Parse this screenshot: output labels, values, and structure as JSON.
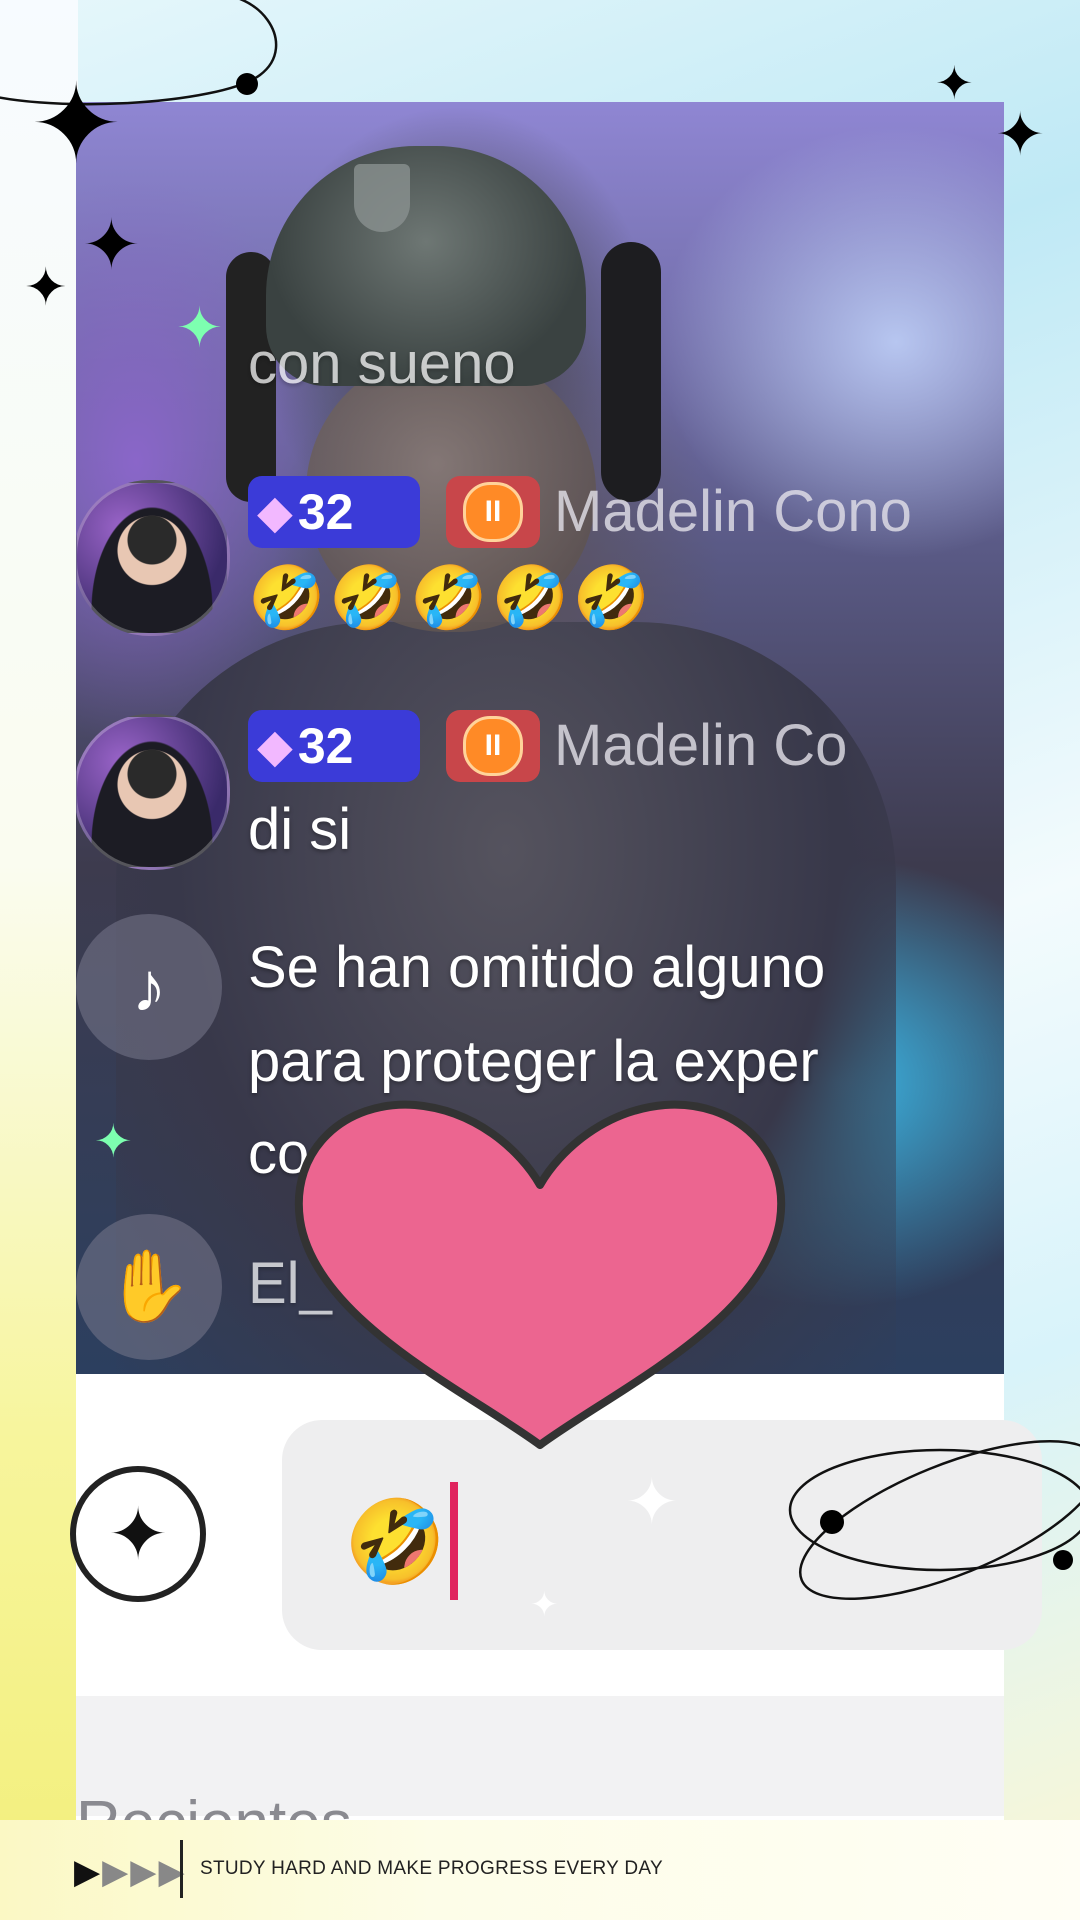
{
  "chat": {
    "messages": [
      {
        "text": "con sueno"
      },
      {
        "level": "32",
        "fan_badge": "II",
        "username": "Madelin Cono",
        "text": "🤣🤣🤣🤣🤣"
      },
      {
        "level": "32",
        "fan_badge": "II",
        "username": "Madelin Co",
        "text": "di si"
      },
      {
        "system_text_line1": "Se han omitido alguno",
        "system_text_line2": "para proteger la exper",
        "system_text_line3": "co                la"
      },
      {
        "joined_text": "El_                  ido"
      }
    ]
  },
  "composer": {
    "ai_icon": "sparkle-chat-icon",
    "input_value": "🤣",
    "caret_color": "#e0245e"
  },
  "recent": {
    "label": "Recientes"
  },
  "footer": {
    "arrows": "▶▶▶▶",
    "tagline": "STUDY HARD AND MAKE PROGRESS EVERY DAY"
  },
  "colors": {
    "level_badge": "#3b3bd8",
    "fan_badge": "#c8464a",
    "heart": "#ec6590"
  }
}
